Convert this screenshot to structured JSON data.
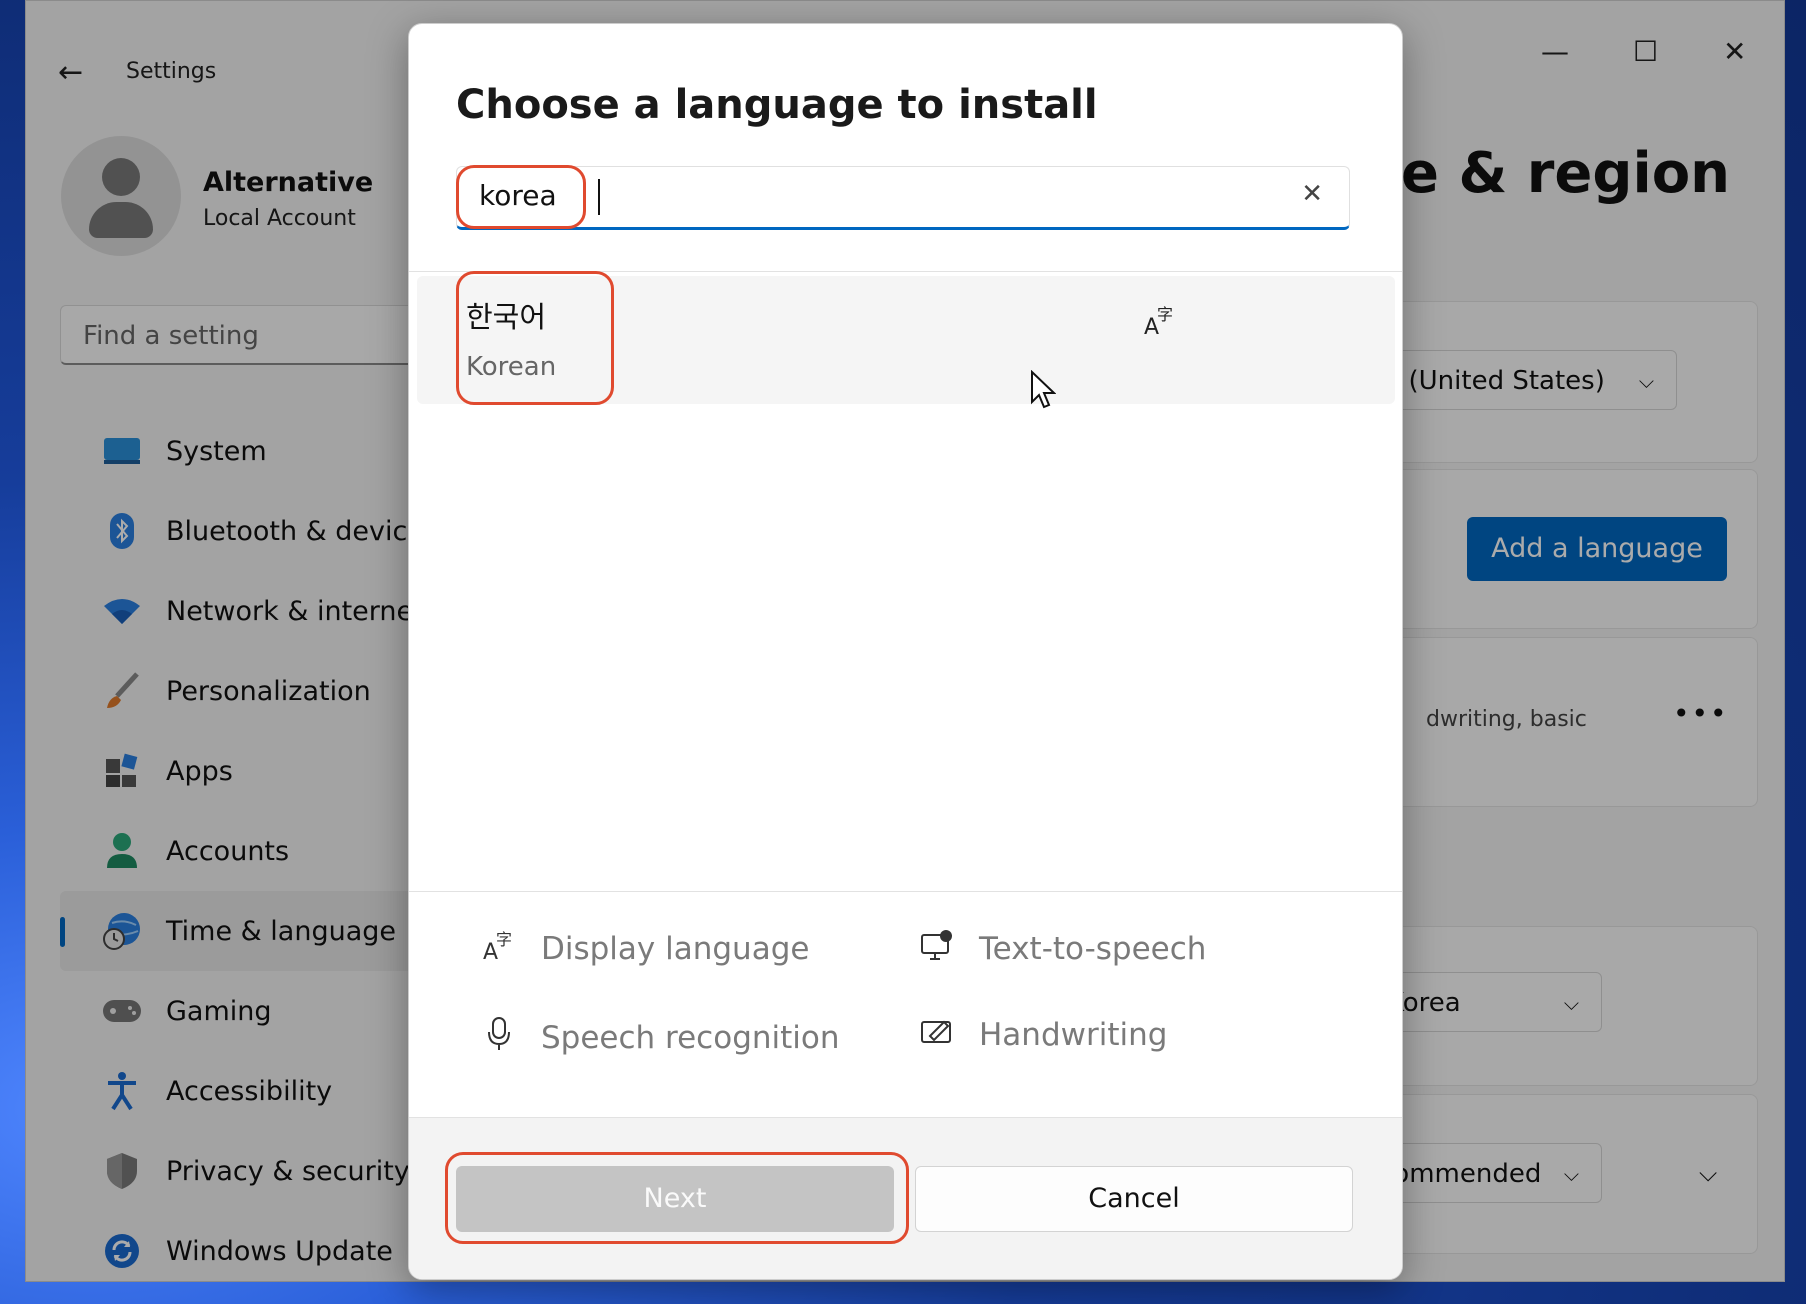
{
  "window": {
    "app_title": "Settings",
    "controls": {
      "minimize": "—",
      "maximize": "☐",
      "close": "✕"
    }
  },
  "account": {
    "name": "Alternative",
    "type": "Local Account"
  },
  "search_setting": {
    "placeholder": "Find a setting"
  },
  "sidebar": {
    "items": [
      {
        "label": "System",
        "icon": "monitor-icon"
      },
      {
        "label": "Bluetooth & devices",
        "icon": "bluetooth-icon"
      },
      {
        "label": "Network & internet",
        "icon": "wifi-icon"
      },
      {
        "label": "Personalization",
        "icon": "brush-icon"
      },
      {
        "label": "Apps",
        "icon": "apps-icon"
      },
      {
        "label": "Accounts",
        "icon": "person-icon"
      },
      {
        "label": "Time & language",
        "icon": "globe-clock-icon",
        "active": true
      },
      {
        "label": "Gaming",
        "icon": "gamepad-icon"
      },
      {
        "label": "Accessibility",
        "icon": "accessibility-icon"
      },
      {
        "label": "Privacy & security",
        "icon": "shield-icon"
      },
      {
        "label": "Windows Update",
        "icon": "update-icon"
      }
    ]
  },
  "main": {
    "heading_fragment": "e & region",
    "display_language_value": "ish (United States)",
    "add_language_label": "Add a language",
    "language_features_fragment": "dwriting, basic",
    "more_label": "•••",
    "region_value": "Korea",
    "format_value": "ecommended"
  },
  "dialog": {
    "title": "Choose a language to install",
    "search_value": "korea",
    "result": {
      "native": "한국어",
      "english": "Korean"
    },
    "features": [
      {
        "label": "Display language",
        "icon": "display-language-icon"
      },
      {
        "label": "Text-to-speech",
        "icon": "text-to-speech-icon"
      },
      {
        "label": "Speech recognition",
        "icon": "microphone-icon"
      },
      {
        "label": "Handwriting",
        "icon": "handwriting-icon"
      }
    ],
    "next_label": "Next",
    "cancel_label": "Cancel"
  },
  "colors": {
    "accent": "#0067c0",
    "highlight": "#e04a2f"
  }
}
